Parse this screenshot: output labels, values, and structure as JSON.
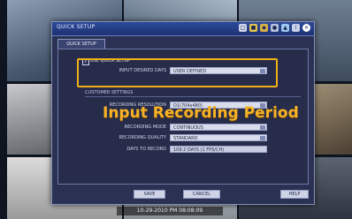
{
  "window": {
    "title": "QUICK SETUP"
  },
  "tab": {
    "label": "QUICK SETUP"
  },
  "form": {
    "use_quick_setup": {
      "label": "USE QUICK SETUP",
      "checked": true
    },
    "input_desired_days": {
      "label": "INPUT DESIRED DAYS",
      "value": "USER DEFINED"
    },
    "section_title": "CUSTOMER SETTINGS",
    "recording_resolution": {
      "label": "RECORDING RESOLUTION",
      "value": "D1(704x480)"
    },
    "recording_mode": {
      "label": "RECORDING MODE",
      "value": "CONTINUOUS"
    },
    "recording_quality": {
      "label": "RECORDING QUALITY",
      "value": "STANDARD"
    },
    "days_to_record": {
      "label": "DAYS TO RECORD",
      "value": "109.2 DAYS (1 FPS/CH)"
    }
  },
  "overlay_caption": "Input Recording Period",
  "buttons": {
    "save": "SAVE",
    "cancel": "CANCEL",
    "help": "HELP"
  },
  "status_bar": {
    "text": "10-29-2010 PM 08:08:09"
  },
  "colors": {
    "highlight": "#f0b018",
    "titlebar": "#1d3272",
    "dialog_bg": "#2a3152"
  },
  "titlebar_icons": [
    "camera-icon",
    "folder-icon",
    "lock-icon",
    "record-icon",
    "network-icon",
    "info-icon",
    "close-icon"
  ]
}
